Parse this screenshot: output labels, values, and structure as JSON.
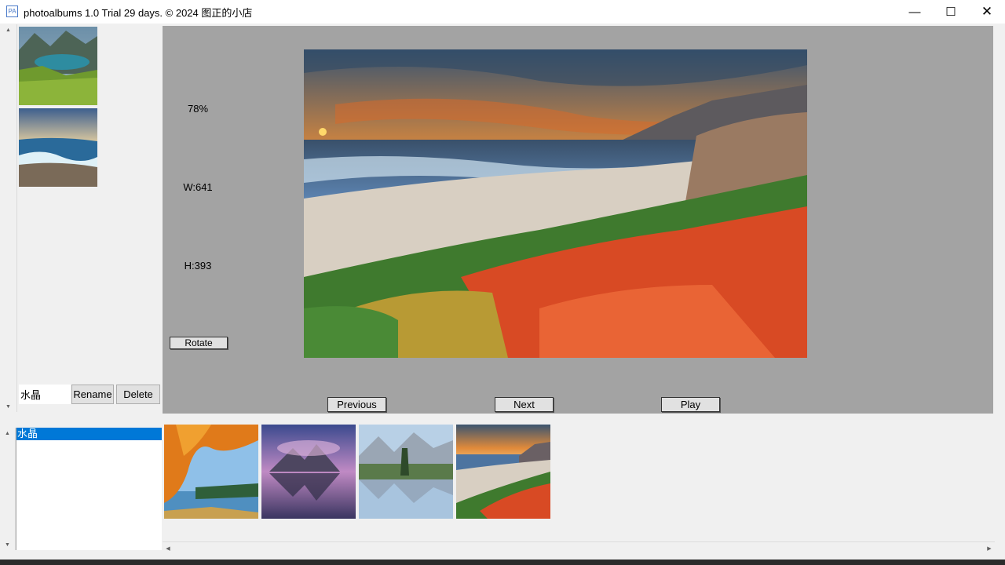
{
  "window": {
    "title": "photoalbums 1.0 Trial 29 days. © 2024 图正的小店",
    "app_icon": "PA",
    "controls": {
      "minimize": "—",
      "maximize": "☐",
      "close": "✕"
    }
  },
  "left_pane": {
    "thumbnails": [
      {
        "name": "mountain-lake-meadow-thumbnail"
      },
      {
        "name": "ocean-wave-beach-thumbnail"
      }
    ],
    "rename_value": "水晶",
    "rename_button": "Rename",
    "delete_button": "Delete"
  },
  "viewer": {
    "zoom": "78%",
    "width": "W:641",
    "height": "H:393",
    "rotate_button": "Rotate",
    "previous_button": "Previous",
    "next_button": "Next",
    "play_button": "Play"
  },
  "album_list": {
    "items": [
      "水晶"
    ],
    "selected_index": 0
  },
  "bottom_thumbnails": [
    {
      "name": "autumn-tree-lake"
    },
    {
      "name": "mountain-reflection-sunset"
    },
    {
      "name": "alpine-lake-reflection"
    },
    {
      "name": "coast-flowers-sunset"
    }
  ],
  "icons": {
    "scroll_up": "▲",
    "scroll_down": "▼",
    "scroll_left": "◀",
    "scroll_right": "▶"
  },
  "colors": {
    "selection": "#0078d7",
    "viewer_bg": "#a3a3a3"
  }
}
